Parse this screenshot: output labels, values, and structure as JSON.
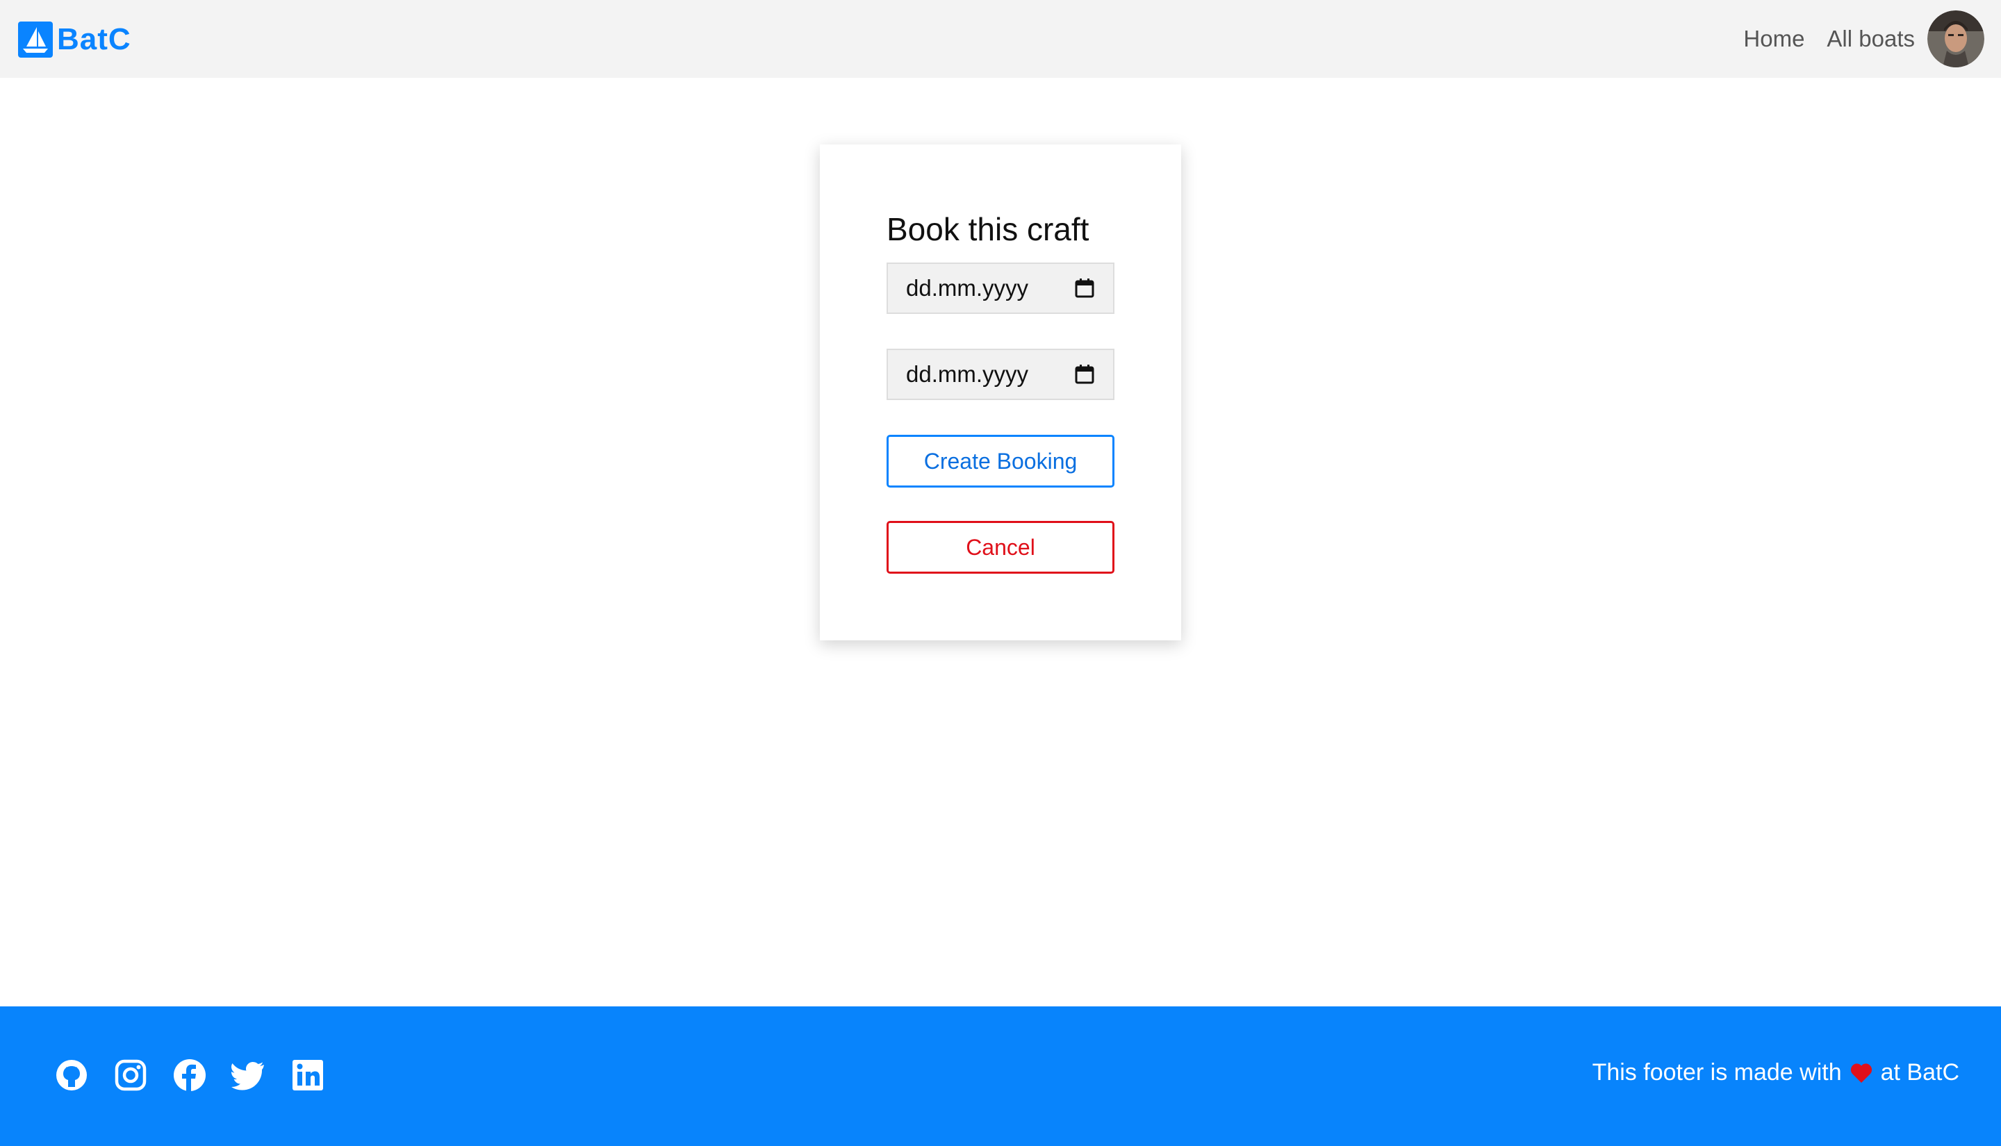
{
  "header": {
    "brand_name": "BatC",
    "nav": {
      "home": "Home",
      "all_boats": "All boats"
    },
    "avatar_alt": "user avatar"
  },
  "booking_card": {
    "title": "Book this craft",
    "start_date": {
      "value": "",
      "placeholder": "dd.mm.yyyy"
    },
    "end_date": {
      "value": "",
      "placeholder": "dd.mm.yyyy"
    },
    "create_label": "Create Booking",
    "cancel_label": "Cancel"
  },
  "footer": {
    "social_icons": [
      "github-icon",
      "instagram-icon",
      "facebook-icon",
      "twitter-icon",
      "linkedin-icon"
    ],
    "text_before": "This footer is made with",
    "text_after": "at BatC"
  },
  "colors": {
    "brand_blue": "#0a84ff",
    "footer_blue": "#0884fc",
    "cancel_red": "#e0101a",
    "header_bg": "#f3f3f3"
  }
}
